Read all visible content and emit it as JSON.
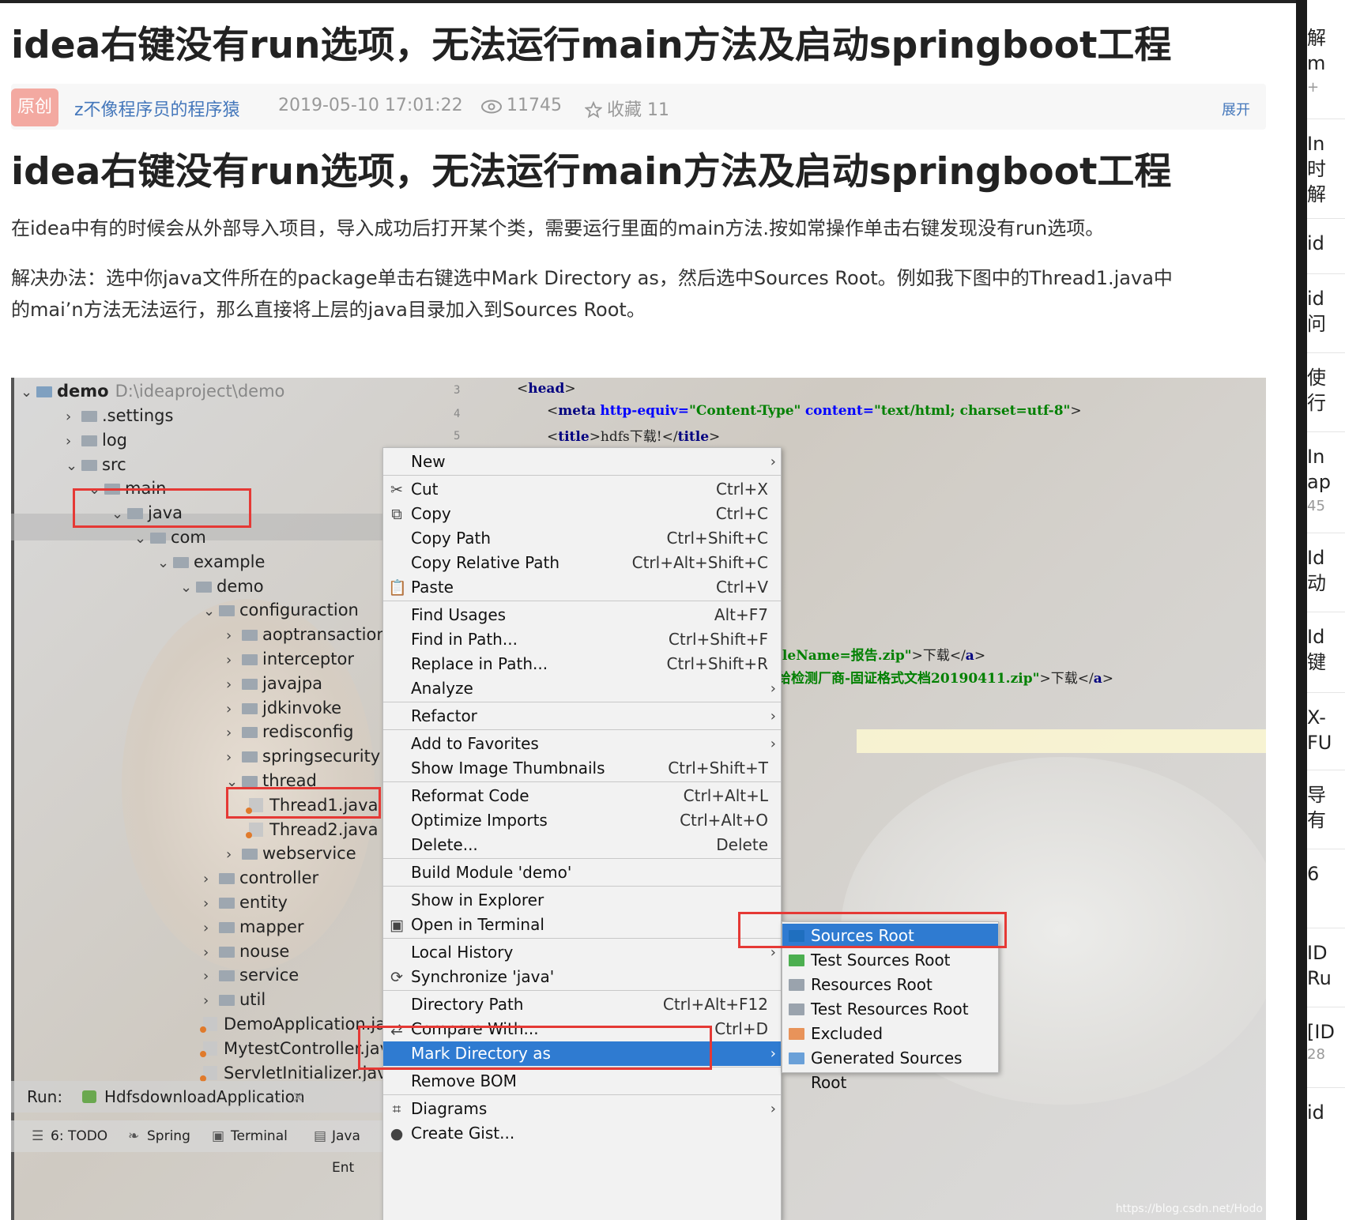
{
  "article": {
    "title": "idea右键没有run选项，无法运行main方法及启动springboot工程",
    "meta": {
      "badge": "原创",
      "author": "z不像程序员的程序猿",
      "date": "2019-05-10 17:01:22",
      "views": "11745",
      "favorites": "收藏 11",
      "expand": "展开"
    },
    "heading": "idea右键没有run选项，无法运行main方法及启动springboot工程",
    "para1": "在idea中有的时候会从外部导入项目，导入成功后打开某个类，需要运行里面的main方法.按如常操作单击右键发现没有run选项。",
    "para2a": "解决办法：选中你java文件所在的package单击右键选中Mark Directory as，然后选中Sources Root。例如我下图中的Thread1.java中",
    "para2b": "的mai’n方法无法运行，那么直接将上层的java目录加入到Sources Root。"
  },
  "screenshot": {
    "tree": {
      "root_name": "demo",
      "root_path": "D:\\ideaproject\\demo",
      "items": [
        {
          "arrow": "›",
          "label": ".settings"
        },
        {
          "arrow": "›",
          "label": "log"
        },
        {
          "arrow": "⌄",
          "label": "src"
        },
        {
          "arrow": "⌄",
          "label": "main"
        },
        {
          "arrow": "⌄",
          "label": "java"
        },
        {
          "arrow": "⌄",
          "label": "com"
        },
        {
          "arrow": "⌄",
          "label": "example"
        },
        {
          "arrow": "⌄",
          "label": "demo"
        },
        {
          "arrow": "⌄",
          "label": "configuraction"
        },
        {
          "arrow": "›",
          "label": "aoptransaction"
        },
        {
          "arrow": "›",
          "label": "interceptor"
        },
        {
          "arrow": "›",
          "label": "javajpa"
        },
        {
          "arrow": "›",
          "label": "jdkinvoke"
        },
        {
          "arrow": "›",
          "label": "redisconfig"
        },
        {
          "arrow": "›",
          "label": "springsecurity"
        },
        {
          "arrow": "⌄",
          "label": "thread"
        },
        {
          "arrow": "",
          "label": "Thread1.java"
        },
        {
          "arrow": "",
          "label": "Thread2.java"
        },
        {
          "arrow": "›",
          "label": "webservice"
        },
        {
          "arrow": "›",
          "label": "controller"
        },
        {
          "arrow": "›",
          "label": "entity"
        },
        {
          "arrow": "›",
          "label": "mapper"
        },
        {
          "arrow": "›",
          "label": "nouse"
        },
        {
          "arrow": "›",
          "label": "service"
        },
        {
          "arrow": "›",
          "label": "util"
        },
        {
          "arrow": "",
          "label": "DemoApplication.java"
        },
        {
          "arrow": "",
          "label": "MytestController.java"
        },
        {
          "arrow": "",
          "label": "ServletInitializer.java"
        }
      ]
    },
    "gutter": [
      "3",
      "4",
      "5"
    ],
    "code": {
      "line1_open": "<",
      "line1_tag": "head",
      "line1_close": ">",
      "line2_open": "<",
      "line2_tag": "meta",
      "line2_attr1": "http-equiv=",
      "line2_val1": "\"Content-Type\"",
      "line2_attr2": "content=",
      "line2_val2": "\"text/html; charset=utf-8\"",
      "line2_close": ">",
      "line3_open": "<",
      "line3_tag": "title",
      "line3_mid": ">hdfs下载!</",
      "line3_tag2": "title",
      "line3_close": ">",
      "line4_val": ".leName=报告.zip\"",
      "line4_txt": ">下载</",
      "line4_tag": "a",
      "line4_close": ">",
      "line5_val": "给检测厂商-固证格式文档20190411.zip\"",
      "line5_txt": ">下载</",
      "line5_tag": "a",
      "line5_close": ">"
    },
    "context_menu": [
      {
        "label": "New",
        "shortcut": "",
        "sub": "›",
        "icon": ""
      },
      {
        "label": "Cut",
        "shortcut": "Ctrl+X",
        "sub": "",
        "icon": "✂"
      },
      {
        "label": "Copy",
        "shortcut": "Ctrl+C",
        "sub": "",
        "icon": "⧉"
      },
      {
        "label": "Copy Path",
        "shortcut": "Ctrl+Shift+C",
        "sub": "",
        "icon": ""
      },
      {
        "label": "Copy Relative Path",
        "shortcut": "Ctrl+Alt+Shift+C",
        "sub": "",
        "icon": ""
      },
      {
        "label": "Paste",
        "shortcut": "Ctrl+V",
        "sub": "",
        "icon": "📋"
      },
      {
        "label": "Find Usages",
        "shortcut": "Alt+F7",
        "sub": "",
        "icon": ""
      },
      {
        "label": "Find in Path...",
        "shortcut": "Ctrl+Shift+F",
        "sub": "",
        "icon": ""
      },
      {
        "label": "Replace in Path...",
        "shortcut": "Ctrl+Shift+R",
        "sub": "",
        "icon": ""
      },
      {
        "label": "Analyze",
        "shortcut": "",
        "sub": "›",
        "icon": ""
      },
      {
        "label": "Refactor",
        "shortcut": "",
        "sub": "›",
        "icon": ""
      },
      {
        "label": "Add to Favorites",
        "shortcut": "",
        "sub": "›",
        "icon": ""
      },
      {
        "label": "Show Image Thumbnails",
        "shortcut": "Ctrl+Shift+T",
        "sub": "",
        "icon": ""
      },
      {
        "label": "Reformat Code",
        "shortcut": "Ctrl+Alt+L",
        "sub": "",
        "icon": ""
      },
      {
        "label": "Optimize Imports",
        "shortcut": "Ctrl+Alt+O",
        "sub": "",
        "icon": ""
      },
      {
        "label": "Delete...",
        "shortcut": "Delete",
        "sub": "",
        "icon": ""
      },
      {
        "label": "Build Module 'demo'",
        "shortcut": "",
        "sub": "",
        "icon": ""
      },
      {
        "label": "Show in Explorer",
        "shortcut": "",
        "sub": "",
        "icon": ""
      },
      {
        "label": "Open in Terminal",
        "shortcut": "",
        "sub": "",
        "icon": "▣"
      },
      {
        "label": "Local History",
        "shortcut": "",
        "sub": "›",
        "icon": ""
      },
      {
        "label": "Synchronize 'java'",
        "shortcut": "",
        "sub": "",
        "icon": "⟳"
      },
      {
        "label": "Directory Path",
        "shortcut": "Ctrl+Alt+F12",
        "sub": "",
        "icon": ""
      },
      {
        "label": "Compare With...",
        "shortcut": "Ctrl+D",
        "sub": "",
        "icon": "⇄"
      },
      {
        "label": "Mark Directory as",
        "shortcut": "",
        "sub": "›",
        "icon": ""
      },
      {
        "label": "Remove BOM",
        "shortcut": "",
        "sub": "",
        "icon": ""
      },
      {
        "label": "Diagrams",
        "shortcut": "",
        "sub": "›",
        "icon": "⌗"
      },
      {
        "label": "Create Gist...",
        "shortcut": "",
        "sub": "",
        "icon": "●"
      }
    ],
    "submenu": [
      {
        "label": "Sources Root",
        "color": "#1f6fbf"
      },
      {
        "label": "Test Sources Root",
        "color": "#4caf50"
      },
      {
        "label": "Resources Root",
        "color": "#9aa3ad"
      },
      {
        "label": "Test Resources Root",
        "color": "#9aa3ad"
      },
      {
        "label": "Excluded",
        "color": "#e8935a"
      },
      {
        "label": "Generated Sources Root",
        "color": "#6aa0d8"
      }
    ],
    "run_label": "Run:",
    "run_app": "HdfsdownloadApplication",
    "run_close": "×",
    "toolbar": {
      "todo": "6: TODO",
      "spring": "Spring",
      "terminal": "Terminal",
      "java_ent": "Java Ent"
    },
    "watermark": "https://blog.csdn.net/Hodo"
  },
  "sidebar_items": [
    {
      "line1": "解",
      "line2": "m",
      "extra": "+"
    },
    {
      "line1": "In",
      "line2": "时",
      "line3": "解"
    },
    {
      "line1": "id"
    },
    {
      "line1": "id",
      "line2": "问"
    },
    {
      "line1": "使",
      "line2": "行"
    },
    {
      "line1": "In",
      "line2": "ap",
      "extra": "45"
    },
    {
      "line1": "Id",
      "line2": "动"
    },
    {
      "line1": "Id",
      "line2": "键"
    },
    {
      "line1": "X-",
      "line2": "FU"
    },
    {
      "line1": "导",
      "line2": "有"
    },
    {
      "line1": "6"
    },
    {
      "line1": "ID",
      "line2": "Ru"
    },
    {
      "line1": "[ID",
      "extra": "28"
    },
    {
      "line1": "id"
    }
  ]
}
